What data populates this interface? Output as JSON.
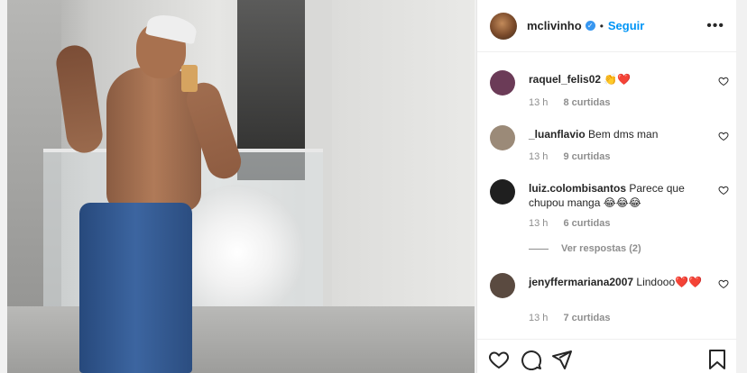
{
  "post": {
    "username": "mclivinho",
    "follow_label": "Seguir",
    "separator": "•",
    "more_label": "•••",
    "verified_glyph": "✓"
  },
  "comments": [
    {
      "username": "raquel_felis02",
      "text": "👏❤️",
      "time": "13 h",
      "likes": "8 curtidas",
      "avatar_color": "#6b3b57"
    },
    {
      "username": "_luanflavio",
      "text": "Bem dms man",
      "time": "13 h",
      "likes": "9 curtidas",
      "avatar_color": "#9b8a78"
    },
    {
      "username": "luiz.colombisantos",
      "text": "Parece que chupou manga 😂😂😂",
      "time": "13 h",
      "likes": "6 curtidas",
      "avatar_color": "#1f1f1f"
    },
    {
      "username": "jenyffermariana2007",
      "text": "Lindooo❤️❤️",
      "time": "13 h",
      "likes": "7 curtidas",
      "avatar_color": "#5a4a40"
    }
  ],
  "view_replies": "Ver respostas (2)",
  "icons": {
    "like": "heart-icon",
    "comment": "comment-icon",
    "share": "share-icon",
    "save": "bookmark-icon",
    "more": "more-icon",
    "verified": "verified-badge-icon"
  },
  "colors": {
    "link": "#0095f6",
    "verified": "#3897f0",
    "muted": "#8e8e8e",
    "text": "#262626"
  }
}
